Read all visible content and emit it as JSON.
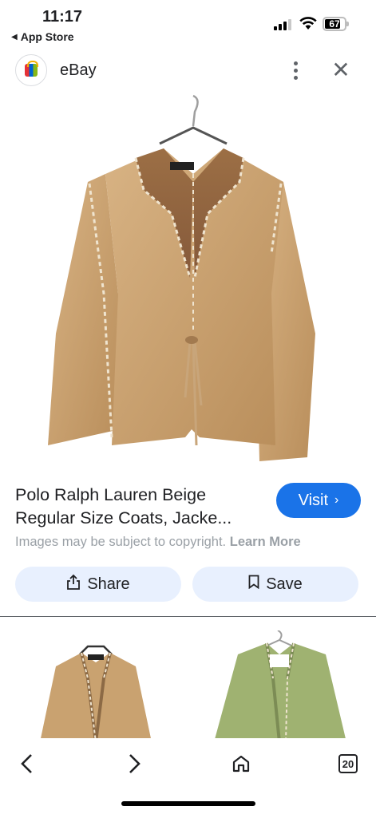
{
  "status_bar": {
    "time": "11:17",
    "back_app": "App Store",
    "battery": "67"
  },
  "source": {
    "name": "eBay",
    "logo_icon": "ebay-shopping-bag-icon"
  },
  "product": {
    "title_line1": "Polo Ralph Lauren Beige",
    "title_line2": "Regular Size Coats, Jacke...",
    "visit_label": "Visit",
    "copyright_text": "Images may be subject to copyright.",
    "learn_more": "Learn More"
  },
  "actions": {
    "share_label": "Share",
    "save_label": "Save"
  },
  "toolbar": {
    "tab_count": "20"
  },
  "colors": {
    "accent": "#1a73e8",
    "chip_bg": "#e8f0fe",
    "jacket_tan": "#c9a270",
    "jacket_green": "#9fb271"
  }
}
